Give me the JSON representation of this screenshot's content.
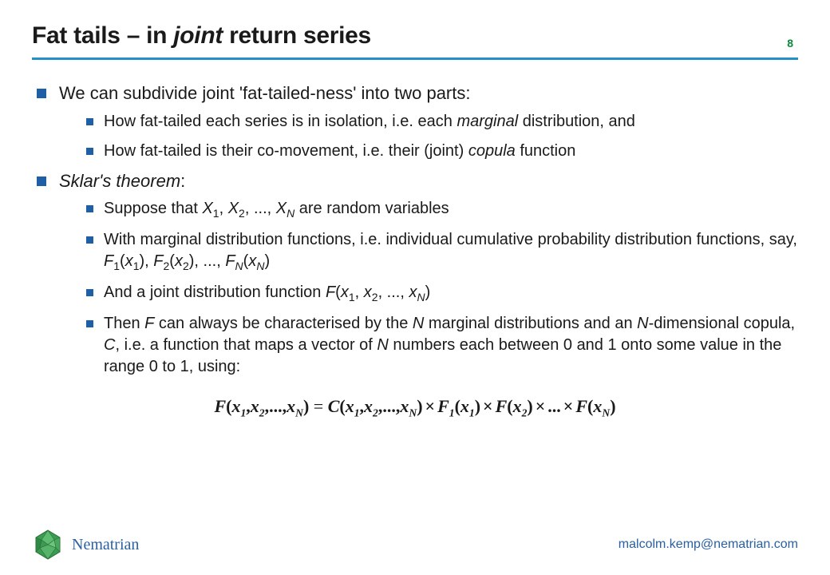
{
  "header": {
    "title_prefix": "Fat tails – in ",
    "title_italic": "joint",
    "title_suffix": " return series",
    "page_number": "8"
  },
  "content": {
    "b1": "We can subdivide joint 'fat-tailed-ness' into two parts:",
    "b1_s1_a": "How fat-tailed each series is in isolation, i.e. each ",
    "b1_s1_it": "marginal",
    "b1_s1_b": " distribution, and",
    "b1_s2_a": "How fat-tailed is their co-movement, i.e. their (joint) ",
    "b1_s2_it": "copula",
    "b1_s2_b": " function",
    "b2_it": "Sklar's theorem",
    "b2_suffix": ":",
    "b2_s1_a": "Suppose that ",
    "b2_s1_b": ", ",
    "b2_s1_c": ", ..., ",
    "b2_s1_d": " are random variables",
    "b2_s2_a": "With marginal distribution functions, i.e. individual cumulative probability distribution functions, say, ",
    "b2_s2_F1": "F",
    "b2_s2_mid1": "(",
    "b2_s2_mid2": "), ",
    "b2_s2_mid3": "), ..., ",
    "b2_s2_end": ")",
    "b2_s3_a": "And a joint distribution function ",
    "b2_s3_F": "F",
    "b2_s3_mid": "(",
    "b2_s3_end": ")",
    "b2_s4_a": "Then ",
    "b2_s4_b": " can always be characterised by the ",
    "b2_s4_c": " marginal distributions and an ",
    "b2_s4_d": "-dimensional copula, ",
    "b2_s4_e": ", i.e. a function that maps a vector of ",
    "b2_s4_f": " numbers each between 0 and 1 onto some value in the range 0 to 1, using:",
    "sym_X": "X",
    "sym_x": "x",
    "sym_N": "N",
    "sym_F": "F",
    "sym_C": "C",
    "sub1": "1",
    "sub2": "2"
  },
  "formula": {
    "lhs_F": "F",
    "paren_open": "(",
    "paren_close": ")",
    "x": "x",
    "sub1": "1",
    "sub2": "2",
    "subN": "N",
    "comma": ",",
    "dots": "...",
    "eq": " = ",
    "C": "C",
    "times": "×",
    "F1": "F",
    "F": "F"
  },
  "footer": {
    "brand": "Nematrian",
    "email": "malcolm.kemp@nematrian.com"
  },
  "colors": {
    "rule": "#2590c8",
    "bullet": "#1f5fa6",
    "brand": "#2a5fa0",
    "page_num": "#0a8a3a"
  }
}
